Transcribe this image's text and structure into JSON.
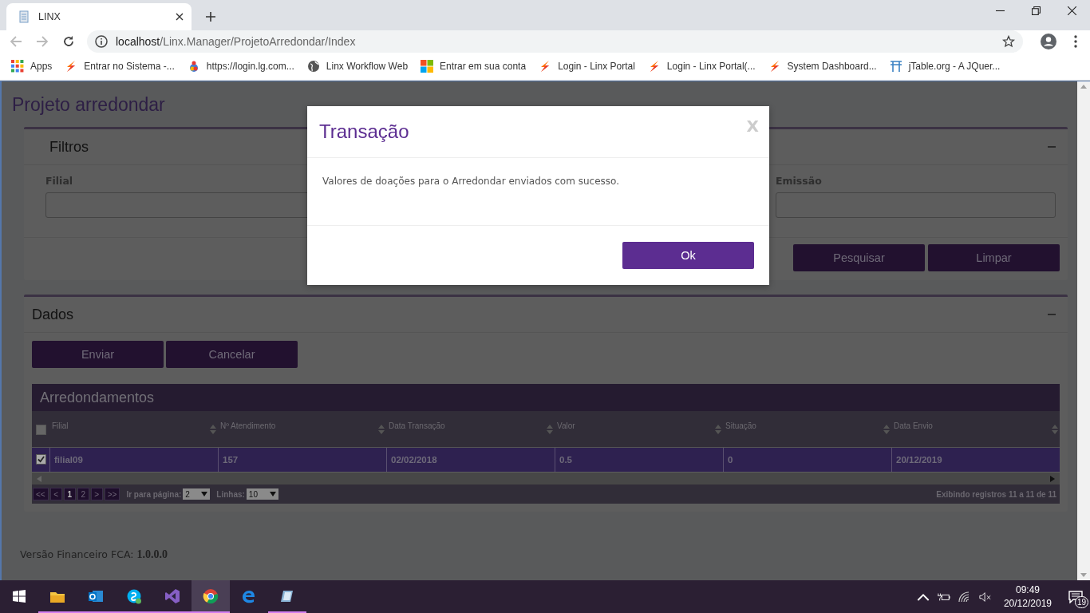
{
  "browser": {
    "tabs": [
      {
        "title": "LINX",
        "selected": true
      }
    ],
    "address": {
      "host": "localhost",
      "path": "/Linx.Manager/ProjetoArredondar/Index"
    },
    "bookmarks": [
      {
        "label": "Apps"
      },
      {
        "label": "Entrar no Sistema -..."
      },
      {
        "label": "https://login.lg.com..."
      },
      {
        "label": "Linx Workflow Web"
      },
      {
        "label": "Entrar em sua conta"
      },
      {
        "label": "Login - Linx Portal"
      },
      {
        "label": "Login - Linx Portal(..."
      },
      {
        "label": "System Dashboard..."
      },
      {
        "label": "jTable.org - A JQuer..."
      }
    ]
  },
  "page": {
    "title": "Projeto arredondar",
    "filters": {
      "title": "Filtros",
      "fields": [
        {
          "label": "Filial"
        },
        {
          "label": "Emissão"
        }
      ],
      "buttons": [
        "Pesquisar",
        "Limpar"
      ]
    },
    "data": {
      "title": "Dados",
      "buttons": [
        "Enviar",
        "Cancelar"
      ],
      "table": {
        "title": "Arredondamentos",
        "header_checked": false,
        "columns": [
          "Filial",
          "Nº Atendimento",
          "Data Transação",
          "Valor",
          "Situação",
          "Data Envio"
        ],
        "rows": [
          {
            "selected": true,
            "checked": true,
            "cells": [
              "filial09",
              "157",
              "02/02/2018",
              "0.5",
              "0",
              "20/12/2019"
            ]
          }
        ],
        "pager": {
          "buttons": [
            {
              "label": "<<",
              "selected": false
            },
            {
              "label": "<",
              "selected": false
            },
            {
              "label": "1",
              "selected": true
            },
            {
              "label": "2",
              "selected": false
            },
            {
              "label": ">",
              "selected": false
            },
            {
              "label": ">>",
              "selected": false
            }
          ],
          "goto_label": "Ir para página:",
          "goto_value": "2",
          "rows_label": "Linhas:",
          "rows_value": "10",
          "summary": "Exibindo registros 11 a 11 de 11"
        }
      }
    },
    "footer": {
      "label": "Versão Financeiro FCA:",
      "version": "1.0.0.0"
    }
  },
  "dialog": {
    "title": "Transação",
    "close": "X",
    "message": "Valores de doações para o Arredondar enviados com sucesso.",
    "button": "Ok"
  },
  "taskbar": {
    "apps": [
      {
        "running": false,
        "selected": false
      },
      {
        "running": true,
        "selected": false
      },
      {
        "running": true,
        "selected": false
      },
      {
        "running": true,
        "selected": false
      },
      {
        "running": true,
        "selected": false
      },
      {
        "running": true,
        "selected": true
      },
      {
        "running": false,
        "selected": false
      },
      {
        "running": true,
        "selected": false
      }
    ],
    "time": "09:49",
    "date": "20/12/2019",
    "notifications": "19"
  }
}
